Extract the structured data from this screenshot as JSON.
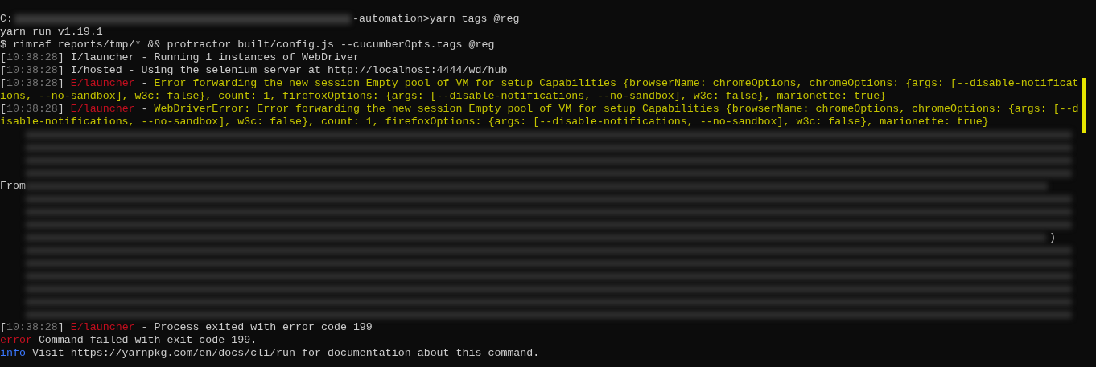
{
  "lines": [
    {
      "kind": "text",
      "segments": [
        {
          "kind": "plain",
          "text": "C:"
        },
        {
          "kind": "redacted"
        },
        {
          "kind": "plain",
          "text": "-automation>yarn tags @reg"
        }
      ]
    },
    {
      "kind": "text",
      "segments": [
        {
          "kind": "plain",
          "text": "yarn run v1.19.1"
        }
      ]
    },
    {
      "kind": "text",
      "segments": [
        {
          "kind": "plain",
          "text": "$ rimraf reports/tmp/* && protractor built/config.js --cucumberOpts.tags @reg"
        }
      ]
    },
    {
      "kind": "text",
      "segments": [
        {
          "kind": "plain",
          "text": "["
        },
        {
          "kind": "dim",
          "text": "10:38:28"
        },
        {
          "kind": "plain",
          "text": "] I/launcher - Running 1 instances of WebDriver"
        }
      ]
    },
    {
      "kind": "text",
      "segments": [
        {
          "kind": "plain",
          "text": "["
        },
        {
          "kind": "dim",
          "text": "10:38:28"
        },
        {
          "kind": "plain",
          "text": "] I/hosted - Using the selenium server at http://localhost:4444/wd/hub"
        }
      ]
    },
    {
      "kind": "text",
      "segments": [
        {
          "kind": "plain",
          "text": "["
        },
        {
          "kind": "dim",
          "text": "10:38:28"
        },
        {
          "kind": "plain",
          "text": "] "
        },
        {
          "kind": "error",
          "text": "E/launcher"
        },
        {
          "kind": "plain",
          "text": " - "
        },
        {
          "kind": "warn",
          "text": "Error forwarding the new session Empty pool of VM for setup Capabilities {browserName: chromeOptions, chromeOptions: {args: [--disable-notificat"
        }
      ]
    },
    {
      "kind": "text",
      "segments": [
        {
          "kind": "warn",
          "text": "ions, --no-sandbox], w3c: false}, count: 1, firefoxOptions: {args: [--disable-notifications, --no-sandbox], w3c: false}, marionette: true}"
        }
      ]
    },
    {
      "kind": "text",
      "segments": [
        {
          "kind": "plain",
          "text": "["
        },
        {
          "kind": "dim",
          "text": "10:38:28"
        },
        {
          "kind": "plain",
          "text": "] "
        },
        {
          "kind": "error",
          "text": "E/launcher"
        },
        {
          "kind": "plain",
          "text": " - "
        },
        {
          "kind": "warn",
          "text": "WebDriverError: Error forwarding the new session Empty pool of VM for setup Capabilities {browserName: chromeOptions, chromeOptions: {args: [--d"
        }
      ]
    },
    {
      "kind": "text",
      "segments": [
        {
          "kind": "warn",
          "text": "isable-notifications, --no-sandbox], w3c: false}, count: 1, firefoxOptions: {args: [--disable-notifications, --no-sandbox], w3c: false}, marionette: true}"
        }
      ]
    },
    {
      "kind": "redacted"
    },
    {
      "kind": "redacted"
    },
    {
      "kind": "redacted"
    },
    {
      "kind": "redacted"
    },
    {
      "kind": "redacted",
      "prefix": "From"
    },
    {
      "kind": "redacted"
    },
    {
      "kind": "redacted"
    },
    {
      "kind": "redacted"
    },
    {
      "kind": "redacted",
      "suffix": ")"
    },
    {
      "kind": "redacted"
    },
    {
      "kind": "redacted"
    },
    {
      "kind": "redacted"
    },
    {
      "kind": "redacted"
    },
    {
      "kind": "redacted"
    },
    {
      "kind": "redacted"
    },
    {
      "kind": "text",
      "segments": [
        {
          "kind": "plain",
          "text": "["
        },
        {
          "kind": "dim",
          "text": "10:38:28"
        },
        {
          "kind": "plain",
          "text": "] "
        },
        {
          "kind": "error",
          "text": "E/launcher"
        },
        {
          "kind": "plain",
          "text": " - Process exited with error code 199"
        }
      ]
    },
    {
      "kind": "text",
      "segments": [
        {
          "kind": "error",
          "text": "error"
        },
        {
          "kind": "plain",
          "text": " Command failed with exit code 199."
        }
      ]
    },
    {
      "kind": "text",
      "segments": [
        {
          "kind": "info",
          "text": "info"
        },
        {
          "kind": "plain",
          "text": " Visit https://yarnpkg.com/en/docs/cli/run for documentation about this command."
        }
      ]
    }
  ]
}
